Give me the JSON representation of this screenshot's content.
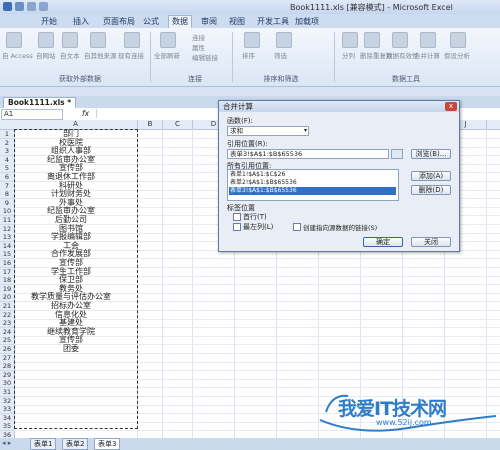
{
  "titlebar": {
    "title": "Book1111.xls [兼容模式] - Microsoft Excel"
  },
  "tabs": [
    "开始",
    "插入",
    "页面布局",
    "公式",
    "数据",
    "审阅",
    "视图",
    "开发工具",
    "加载项"
  ],
  "active_tab": "数据",
  "ribbon": {
    "groups": [
      {
        "label": "获取外部数据",
        "buttons": [
          "自 Access",
          "自网站",
          "自文本",
          "自其他来源",
          "现有连接"
        ]
      },
      {
        "label": "连接",
        "buttons": [
          "全部刷新",
          "连接",
          "属性",
          "编辑链接"
        ]
      },
      {
        "label": "排序和筛选",
        "buttons": [
          "排序",
          "筛选"
        ]
      },
      {
        "label": "数据工具",
        "buttons": [
          "分列",
          "删除重复项",
          "数据有效性",
          "合并计算",
          "假设分析"
        ]
      }
    ]
  },
  "document_tab": "Book1111.xls *",
  "formula_bar": {
    "name_box": "A1",
    "fx": "fx"
  },
  "sheet": {
    "columns": [
      "A",
      "B",
      "C",
      "D",
      "E",
      "F",
      "G",
      "H",
      "I",
      "J",
      "K"
    ],
    "rows": [
      {
        "n": "1",
        "a": "部门"
      },
      {
        "n": "2",
        "a": "校医院"
      },
      {
        "n": "3",
        "a": "组织人事部"
      },
      {
        "n": "4",
        "a": "纪监审办公室"
      },
      {
        "n": "5",
        "a": "宣传部"
      },
      {
        "n": "6",
        "a": "离退休工作部"
      },
      {
        "n": "7",
        "a": "科研处"
      },
      {
        "n": "8",
        "a": "计划财务处"
      },
      {
        "n": "9",
        "a": "外事处"
      },
      {
        "n": "10",
        "a": "纪监审办公室"
      },
      {
        "n": "11",
        "a": "后勤公司"
      },
      {
        "n": "12",
        "a": "图书馆"
      },
      {
        "n": "13",
        "a": "学报编辑部"
      },
      {
        "n": "14",
        "a": "工会"
      },
      {
        "n": "15",
        "a": "合作发展部"
      },
      {
        "n": "16",
        "a": "宣传部"
      },
      {
        "n": "17",
        "a": "学生工作部"
      },
      {
        "n": "18",
        "a": "保卫部"
      },
      {
        "n": "19",
        "a": "教务处"
      },
      {
        "n": "20",
        "a": "教学质量与评估办公室"
      },
      {
        "n": "21",
        "a": "招标办公室"
      },
      {
        "n": "22",
        "a": "信息化处"
      },
      {
        "n": "23",
        "a": "基建处"
      },
      {
        "n": "24",
        "a": "继续教育学院"
      },
      {
        "n": "25",
        "a": "宣传部"
      },
      {
        "n": "26",
        "a": "团委"
      },
      {
        "n": "27",
        "a": ""
      },
      {
        "n": "28",
        "a": ""
      },
      {
        "n": "29",
        "a": ""
      },
      {
        "n": "30",
        "a": ""
      },
      {
        "n": "31",
        "a": ""
      },
      {
        "n": "32",
        "a": ""
      },
      {
        "n": "33",
        "a": ""
      },
      {
        "n": "34",
        "a": ""
      },
      {
        "n": "35",
        "a": ""
      },
      {
        "n": "36",
        "a": ""
      }
    ]
  },
  "sheet_tabs": [
    "表单1",
    "表单2",
    "表单3"
  ],
  "active_sheet": "表单3",
  "dialog": {
    "title": "合并计算",
    "close": "x",
    "function_label": "函数(F):",
    "function_value": "求和",
    "ref_label": "引用位置(R):",
    "ref_value": "表单3!$A$1:$B$65536",
    "browse": "浏览(B)...",
    "all_refs_label": "所有引用位置:",
    "all_refs": [
      "表单1!$A$1:$C$26",
      "表单2!$A$1:$B$65536",
      "表单3!$A$1:$B$65536"
    ],
    "selected_ref_index": 2,
    "add": "添加(A)",
    "delete": "删除(D)",
    "tag_label": "标签位置",
    "first_row": "首行(T)",
    "left_col": "最左列(L)",
    "create_links": "创建指向源数据的链接(S)",
    "ok": "确定",
    "close_btn": "关闭"
  },
  "watermark": {
    "text": "我爱IT技术网",
    "url": "www.52ij.com"
  },
  "colors": {
    "accent": "#3070c8",
    "watermark": "#2f7cc8",
    "close": "#c9463d"
  }
}
